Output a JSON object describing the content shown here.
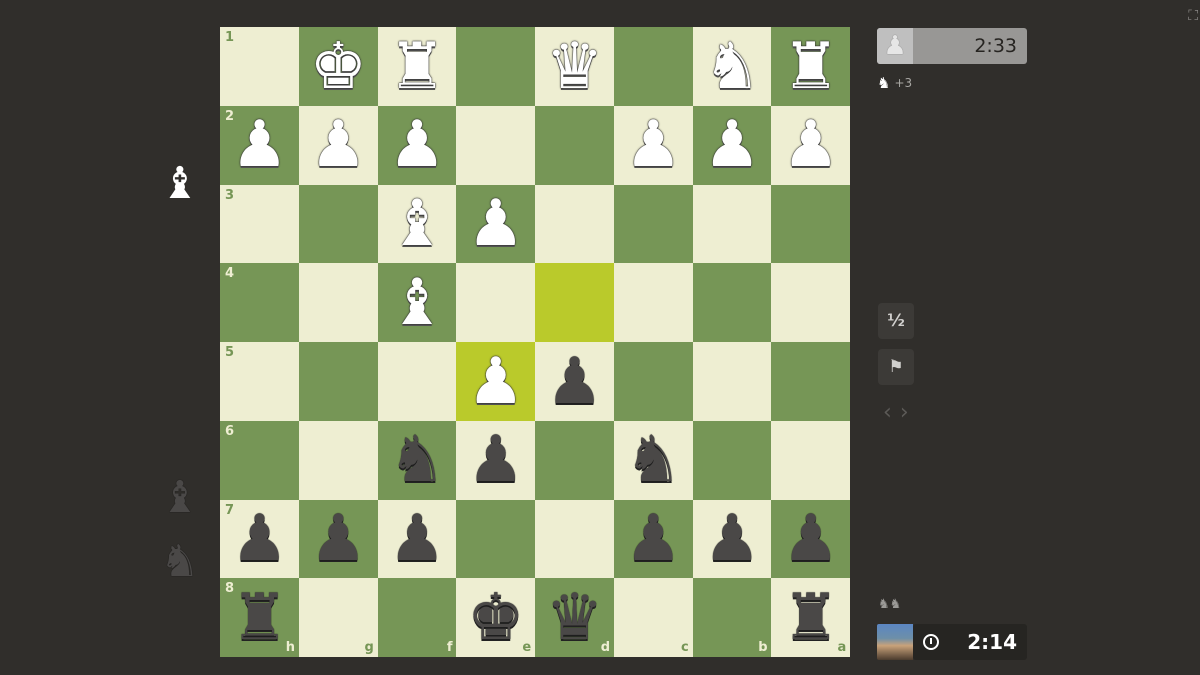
{
  "board": {
    "files": [
      "h",
      "g",
      "f",
      "e",
      "d",
      "c",
      "b",
      "a"
    ],
    "ranks": [
      "1",
      "2",
      "3",
      "4",
      "5",
      "6",
      "7",
      "8"
    ],
    "highlight_squares": [
      "d4",
      "e5"
    ],
    "pieces": {
      "g1": "wK",
      "f1": "wR",
      "d1": "wQ",
      "b1": "wN",
      "a1": "wR",
      "h2": "wP",
      "g2": "wP",
      "f2": "wP",
      "c2": "wP",
      "b2": "wP",
      "a2": "wP",
      "f3": "wB",
      "e3": "wP",
      "f4": "wB",
      "e5": "wP",
      "d5": "bP",
      "f6": "bN",
      "e6": "bP",
      "c6": "bN",
      "h7": "bP",
      "g7": "bP",
      "f7": "bP",
      "c7": "bP",
      "b7": "bP",
      "a7": "bP",
      "h8": "bR",
      "e8": "bK",
      "d8": "bQ",
      "a8": "bR"
    },
    "colors": {
      "light": "#eeeed2",
      "dark": "#769656",
      "highlight_light": "#f6f669",
      "highlight_dark": "#baca2b"
    }
  },
  "captured": {
    "by_black": [
      {
        "piece": "wB"
      }
    ],
    "by_white": [
      {
        "piece": "bB"
      },
      {
        "piece": "bN"
      }
    ]
  },
  "opponent": {
    "clock": "2:33",
    "material_advantage": "+3",
    "material_icon": "knight-icon"
  },
  "player": {
    "clock": "2:14",
    "status_icon": "knights-icon"
  },
  "controls": {
    "draw_label": "½",
    "resign_icon": "flag-icon",
    "prev_icon": "‹",
    "next_icon": "›"
  }
}
